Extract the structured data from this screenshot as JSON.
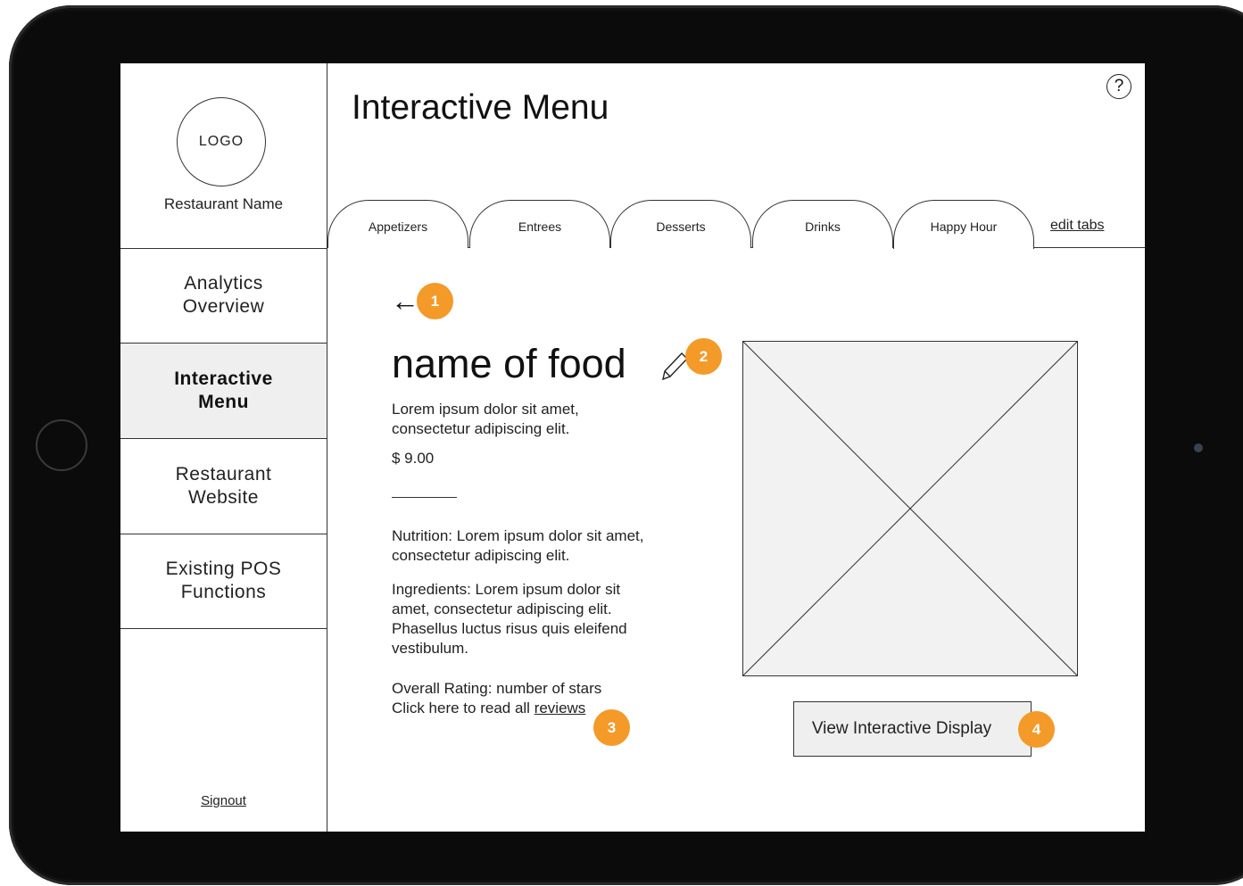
{
  "sidebar": {
    "logo_text": "LOGO",
    "restaurant_name": "Restaurant Name",
    "items": [
      {
        "label": "Analytics\nOverview",
        "active": false
      },
      {
        "label": "Interactive\nMenu",
        "active": true
      },
      {
        "label": "Restaurant\nWebsite",
        "active": false
      },
      {
        "label": "Existing POS\nFunctions",
        "active": false
      }
    ],
    "signout": "Signout"
  },
  "header": {
    "title": "Interactive Menu",
    "help": "?",
    "tabs": [
      "Appetizers",
      "Entrees",
      "Desserts",
      "Drinks",
      "Happy Hour"
    ],
    "active_tab": "Happy Hour",
    "edit_tabs": "edit tabs"
  },
  "item": {
    "back_icon": "arrow-left-icon",
    "name": "name of food",
    "edit_icon": "pencil-icon",
    "description": "Lorem ipsum dolor sit amet, consectetur adipiscing elit.",
    "price": "$ 9.00",
    "nutrition": "Nutrition: Lorem ipsum dolor sit amet, consectetur adipiscing elit.",
    "ingredients": "Ingredients: Lorem ipsum dolor sit amet, consectetur adipiscing elit. Phasellus luctus risus quis eleifend vestibulum.",
    "rating": "Overall Rating: number of stars",
    "reviews_prefix": "Click here to read all ",
    "reviews_link": "reviews",
    "view_button": "View Interactive Display"
  },
  "badges": [
    "1",
    "2",
    "3",
    "4"
  ],
  "colors": {
    "badge": "#f39a28",
    "active_nav": "#efefef",
    "image_bg": "#f2f2f2"
  }
}
